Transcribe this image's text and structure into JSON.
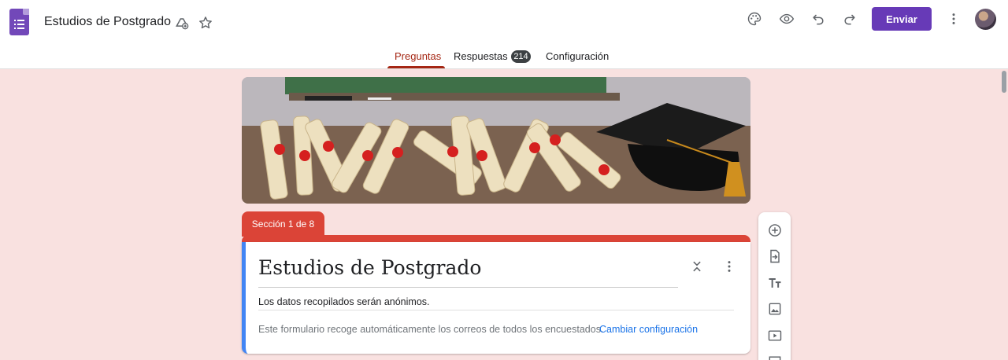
{
  "header": {
    "title": "Estudios de Postgrado",
    "send_label": "Enviar",
    "icons": [
      "forms-app-icon",
      "move-to-drive-icon",
      "star-icon",
      "palette-icon",
      "preview-eye-icon",
      "undo-icon",
      "redo-icon",
      "more-vert-icon",
      "avatar"
    ]
  },
  "tabs": [
    {
      "label": "Preguntas",
      "active": true
    },
    {
      "label": "Respuestas",
      "count": "214"
    },
    {
      "label": "Configuración"
    }
  ],
  "section": {
    "label": "Sección 1 de 8"
  },
  "form": {
    "title": "Estudios de Postgrado",
    "description": "Los datos recopilados serán anónimos.",
    "email_note": "Este formulario recoge automáticamente los correos de todos los encuestados.",
    "change_link": "Cambiar configuración"
  },
  "side_toolbar": {
    "icons": [
      "add-question-icon",
      "import-questions-icon",
      "add-title-icon",
      "add-image-icon",
      "add-video-icon",
      "add-section-icon"
    ]
  },
  "colors": {
    "accent": "#673ab7",
    "active_tab": "#a52714",
    "section": "#db4437",
    "background": "#f9e1e0",
    "link": "#1a73e8"
  }
}
